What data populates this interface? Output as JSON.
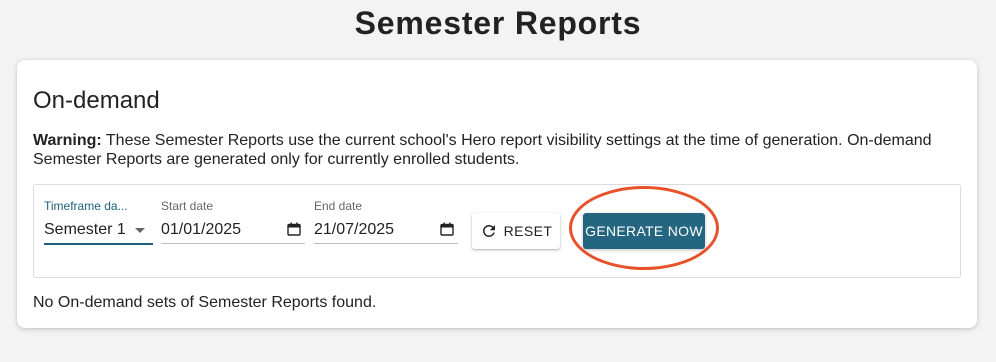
{
  "page": {
    "title": "Semester Reports"
  },
  "on_demand": {
    "section_title": "On-demand",
    "warning_label": "Warning:",
    "warning_text": "These Semester Reports use the current school's Hero report visibility settings at the time of generation. On-demand Semester Reports are generated only for currently enrolled students.",
    "empty_message": "No On-demand sets of Semester Reports found."
  },
  "filters": {
    "timeframe": {
      "label": "Timeframe da...",
      "value": "Semester 1"
    },
    "start_date": {
      "label": "Start date",
      "value": "01/01/2025"
    },
    "end_date": {
      "label": "End date",
      "value": "21/07/2025"
    }
  },
  "buttons": {
    "reset_label": "RESET",
    "reset_icon": "refresh-icon",
    "generate_label": "GENERATE NOW"
  },
  "colors": {
    "accent": "#24657f",
    "highlight_ring": "#e8522b",
    "background": "#f3f3f3"
  }
}
